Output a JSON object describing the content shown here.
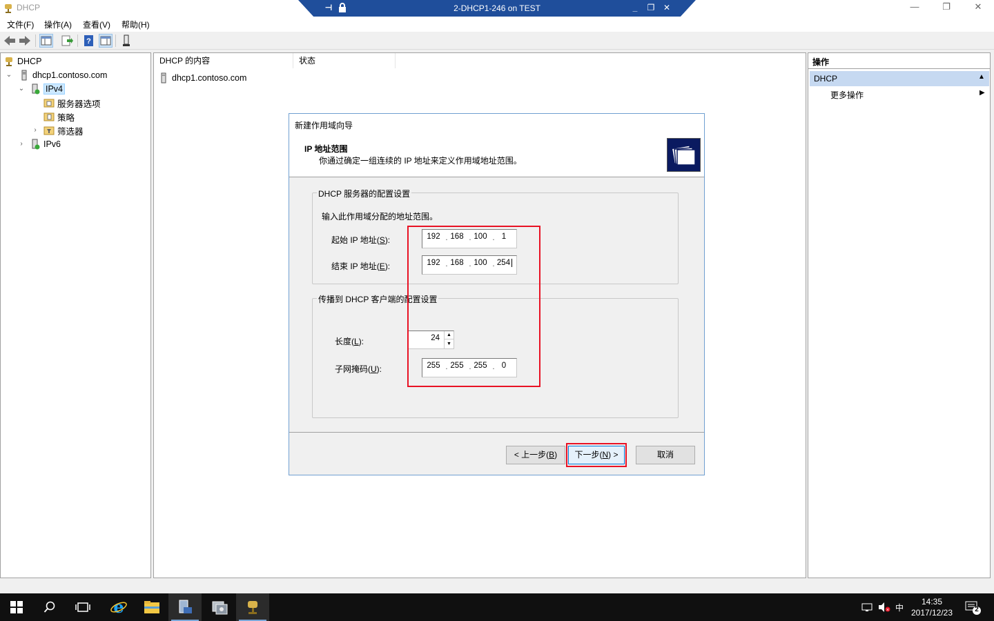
{
  "window": {
    "title": "DHCP",
    "rdp_title": "2-DHCP1-246 on TEST",
    "controls": {
      "minimize": "—",
      "restore": "❐",
      "close": "✕"
    }
  },
  "menu": {
    "items": [
      "文件(F)",
      "操作(A)",
      "查看(V)",
      "帮助(H)"
    ]
  },
  "tree": {
    "root": "DHCP",
    "server": "dhcp1.contoso.com",
    "ipv4": "IPv4",
    "server_options": "服务器选项",
    "policies": "策略",
    "filters": "筛选器",
    "ipv6": "IPv6"
  },
  "content": {
    "col_name": "DHCP 的内容",
    "col_status": "状态",
    "row": "dhcp1.contoso.com"
  },
  "actions": {
    "header": "操作",
    "section": "DHCP",
    "more": "更多操作"
  },
  "wizard": {
    "title": "新建作用域向导",
    "heading": "IP 地址范围",
    "subheading": "你通过确定一组连续的 IP 地址来定义作用域地址范围。",
    "group1_label": "DHCP 服务器的配置设置",
    "group1_instruction": "输入此作用域分配的地址范围。",
    "start_ip_label_pre": "起始 IP 地址(",
    "start_ip_label_key": "S",
    "start_ip_label_post": "):",
    "start_ip": [
      "192",
      "168",
      "100",
      "1"
    ],
    "end_ip_label_pre": "结束 IP 地址(",
    "end_ip_label_key": "E",
    "end_ip_label_post": "):",
    "end_ip": [
      "192",
      "168",
      "100",
      "254"
    ],
    "group2_label": "传播到 DHCP 客户端的配置设置",
    "length_label_pre": "长度(",
    "length_label_key": "L",
    "length_label_post": "):",
    "length": "24",
    "mask_label_pre": "子网掩码(",
    "mask_label_key": "U",
    "mask_label_post": "):",
    "subnet_mask": [
      "255",
      "255",
      "255",
      "0"
    ],
    "back_pre": "< 上一步(",
    "back_key": "B",
    "back_post": ")",
    "next_pre": "下一步(",
    "next_key": "N",
    "next_post": ") >",
    "cancel": "取消"
  },
  "taskbar": {
    "time": "14:35",
    "date": "2017/12/23",
    "ime": "中",
    "notification_count": "2"
  },
  "colors": {
    "highlight_red": "#e81123",
    "rdp_bar": "#1f4e9b",
    "actions_section_bg": "#c6d9f1",
    "taskbar": "#101010"
  }
}
